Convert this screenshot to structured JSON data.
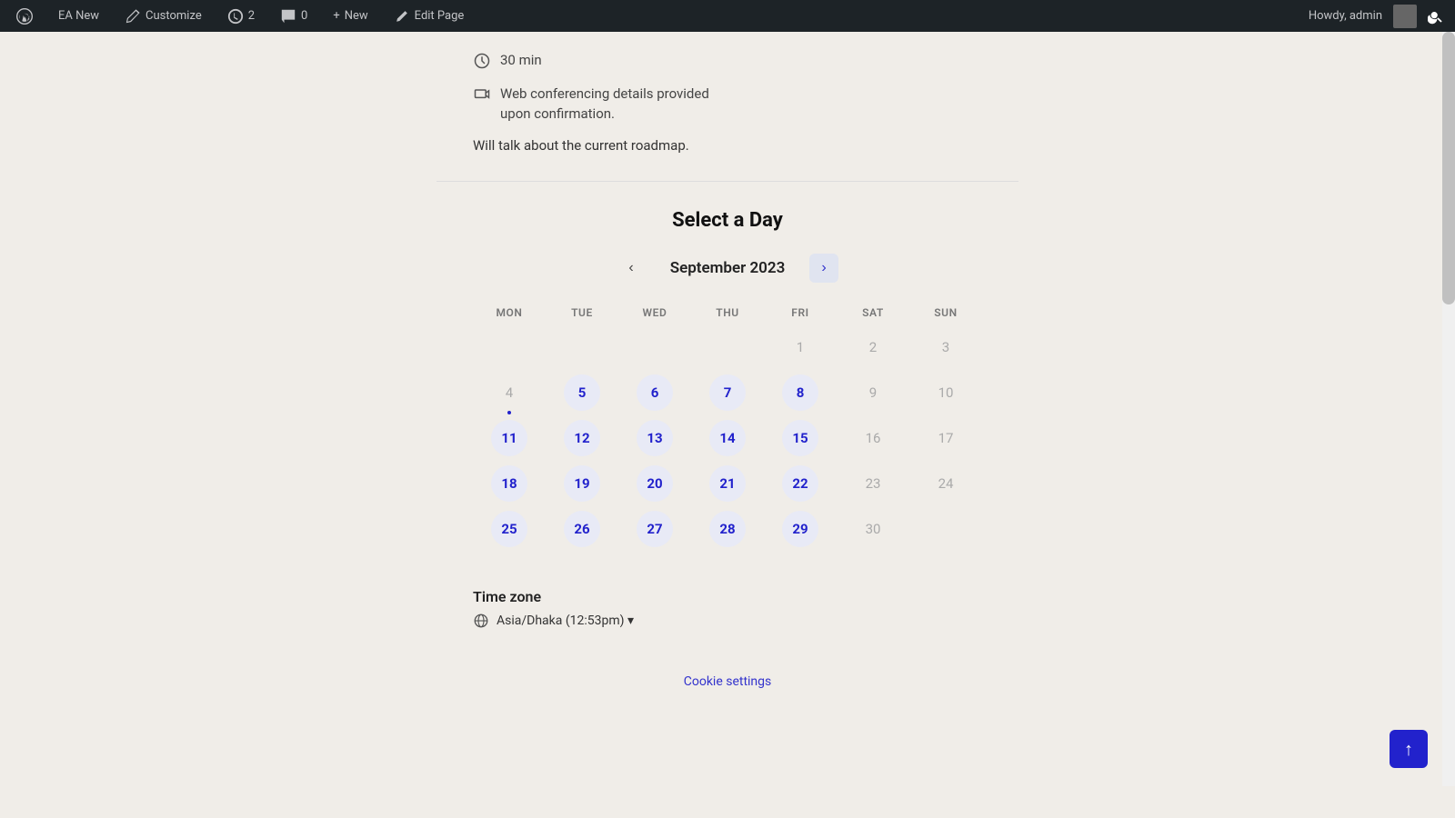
{
  "admin_bar": {
    "wp_logo": "wordpress-logo",
    "site_name": "EA New",
    "customize_label": "Customize",
    "updates_count": "2",
    "comments_count": "0",
    "new_label": "New",
    "edit_page_label": "Edit Page",
    "howdy_label": "Howdy, admin"
  },
  "top_section": {
    "duration": "30 min",
    "conferencing_line1": "Web conferencing details provided",
    "conferencing_line2": "upon confirmation.",
    "roadmap_text": "Will talk about the current roadmap."
  },
  "calendar": {
    "title": "Select a Day",
    "month_label": "September 2023",
    "weekdays": [
      "MON",
      "TUE",
      "WED",
      "THU",
      "FRI",
      "SAT",
      "SUN"
    ],
    "weeks": [
      [
        null,
        null,
        null,
        null,
        {
          "day": 1,
          "type": "unavailable"
        },
        {
          "day": 2,
          "type": "unavailable"
        },
        {
          "day": 3,
          "type": "unavailable"
        }
      ],
      [
        {
          "day": 4,
          "type": "unavailable",
          "dot": true
        },
        {
          "day": 5,
          "type": "available"
        },
        {
          "day": 6,
          "type": "available"
        },
        {
          "day": 7,
          "type": "available"
        },
        {
          "day": 8,
          "type": "available"
        },
        {
          "day": 9,
          "type": "unavailable"
        },
        {
          "day": 10,
          "type": "unavailable"
        }
      ],
      [
        {
          "day": 11,
          "type": "available"
        },
        {
          "day": 12,
          "type": "available"
        },
        {
          "day": 13,
          "type": "available"
        },
        {
          "day": 14,
          "type": "available"
        },
        {
          "day": 15,
          "type": "available"
        },
        {
          "day": 16,
          "type": "unavailable"
        },
        {
          "day": 17,
          "type": "unavailable"
        }
      ],
      [
        {
          "day": 18,
          "type": "available"
        },
        {
          "day": 19,
          "type": "available"
        },
        {
          "day": 20,
          "type": "available"
        },
        {
          "day": 21,
          "type": "available"
        },
        {
          "day": 22,
          "type": "available"
        },
        {
          "day": 23,
          "type": "unavailable"
        },
        {
          "day": 24,
          "type": "unavailable"
        }
      ],
      [
        {
          "day": 25,
          "type": "available"
        },
        {
          "day": 26,
          "type": "available"
        },
        {
          "day": 27,
          "type": "available"
        },
        {
          "day": 28,
          "type": "available"
        },
        {
          "day": 29,
          "type": "available"
        },
        {
          "day": 30,
          "type": "unavailable"
        },
        null
      ]
    ]
  },
  "timezone": {
    "label": "Time zone",
    "value": "Asia/Dhaka (12:53pm) ▾"
  },
  "footer": {
    "cookie_settings": "Cookie settings"
  },
  "scroll_top_label": "↑"
}
